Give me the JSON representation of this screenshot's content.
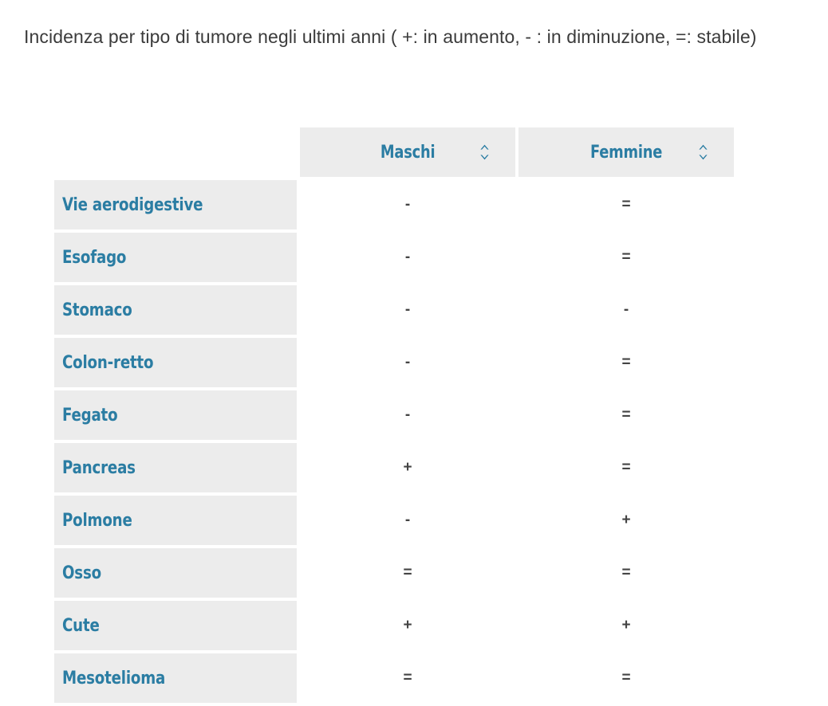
{
  "page": {
    "title": "Incidenza per tipo di tumore negli ultimi anni ( +: in aumento, - : in diminuzione, =: stabile)"
  },
  "theme": {
    "accent": "#2b7da3",
    "row_background": "#ececec",
    "header_background": "#ececec",
    "page_background": "#ffffff",
    "text": "#3b3b3b",
    "value_text": "#444444"
  },
  "table": {
    "row_header_label": "",
    "columns": [
      {
        "label": "Maschi",
        "sort_icon": "sort-updown-icon",
        "sortable": true
      },
      {
        "label": "Femmine",
        "sort_icon": "sort-updown-icon",
        "sortable": true
      }
    ],
    "rows": [
      {
        "label": "Vie aerodigestive",
        "maschi": "-",
        "femmine": "="
      },
      {
        "label": "Esofago",
        "maschi": "-",
        "femmine": "="
      },
      {
        "label": "Stomaco",
        "maschi": "-",
        "femmine": "-"
      },
      {
        "label": "Colon-retto",
        "maschi": "-",
        "femmine": "="
      },
      {
        "label": "Fegato",
        "maschi": "-",
        "femmine": "="
      },
      {
        "label": "Pancreas",
        "maschi": "+",
        "femmine": "="
      },
      {
        "label": "Polmone",
        "maschi": "-",
        "femmine": "+"
      },
      {
        "label": "Osso",
        "maschi": "=",
        "femmine": "="
      },
      {
        "label": "Cute",
        "maschi": "+",
        "femmine": "+"
      },
      {
        "label": "Mesotelioma",
        "maschi": "=",
        "femmine": "="
      }
    ],
    "legend": {
      "plus": "in aumento",
      "minus": "in diminuzione",
      "equals": "stabile"
    }
  }
}
